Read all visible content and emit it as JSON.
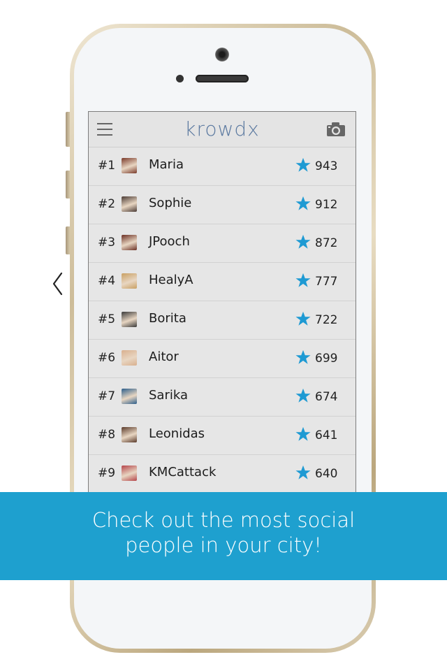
{
  "app": {
    "logo": "krowdx"
  },
  "leaderboard": [
    {
      "rank": "#1",
      "name": "Maria",
      "score": "943",
      "avatar_color": "#7a3a2a"
    },
    {
      "rank": "#2",
      "name": "Sophie",
      "score": "912",
      "avatar_color": "#4a3a34"
    },
    {
      "rank": "#3",
      "name": "JPooch",
      "score": "872",
      "avatar_color": "#6b3024"
    },
    {
      "rank": "#4",
      "name": "HealyA",
      "score": "777",
      "avatar_color": "#c9a063"
    },
    {
      "rank": "#5",
      "name": "Borita",
      "score": "722",
      "avatar_color": "#3a3a3a"
    },
    {
      "rank": "#6",
      "name": "Aitor",
      "score": "699",
      "avatar_color": "#d9b08f"
    },
    {
      "rank": "#7",
      "name": "Sarika",
      "score": "674",
      "avatar_color": "#2d5e8a"
    },
    {
      "rank": "#8",
      "name": "Leonidas",
      "score": "641",
      "avatar_color": "#5a3a2a"
    },
    {
      "rank": "#9",
      "name": "KMCattack",
      "score": "640",
      "avatar_color": "#b5454a"
    }
  ],
  "banner": {
    "line1": "Check out the most social",
    "line2": "people in your city!"
  },
  "colors": {
    "accent": "#1ea0cf",
    "star": "#1e9ad3",
    "logo": "#5b79a0"
  },
  "icons": {
    "menu": "hamburger-icon",
    "camera": "camera-icon",
    "star": "star-icon",
    "back": "chevron-left-icon"
  }
}
